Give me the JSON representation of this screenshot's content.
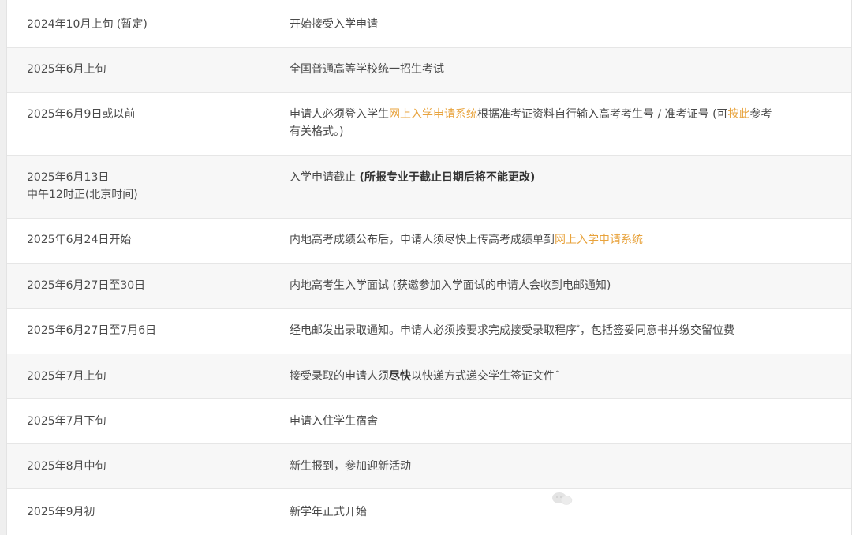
{
  "rows": [
    {
      "date": "2024年10月上旬 (暂定)",
      "desc": "开始接受入学申请"
    },
    {
      "date": "2025年6月上旬",
      "desc": "全国普通高等学校统一招生考试"
    },
    {
      "date": "2025年6月9日或以前",
      "desc_parts": {
        "p1": "申请人必须登入学生",
        "link1": "网上入学申请系统",
        "p2": "根据准考证资料自行输入高考考生号 / 准考证号 (可",
        "link2": "按此",
        "p3": "参考",
        "line2": "有关格式。)"
      }
    },
    {
      "date_line1": "2025年6月13日",
      "date_line2": "中午12时正(北京时间)",
      "desc_parts": {
        "p1": "入学申请截止 ",
        "bold": "(所报专业于截止日期后将不能更改)"
      }
    },
    {
      "date": "2025年6月24日开始",
      "desc_parts": {
        "p1": "内地高考成绩公布后，申请人须尽快上传高考成绩单到",
        "link": "网上入学申请系统"
      }
    },
    {
      "date": "2025年6月27日至30日",
      "desc": "内地高考生入学面试 (获邀参加入学面试的申请人会收到电邮通知)"
    },
    {
      "date": "2025年6月27日至7月6日",
      "desc_parts": {
        "p1": "经电邮发出录取通知。申请人必须按要求完成接受录取程序",
        "sup": "*",
        "p2": "，包括签妥同意书并缴交留位费"
      }
    },
    {
      "date": "2025年7月上旬",
      "desc_parts": {
        "p1": "接受录取的申请人须",
        "bold": "尽快",
        "p2": "以快递方式递交学生签证文件",
        "sup": "^"
      }
    },
    {
      "date": "2025年7月下旬",
      "desc": "申请入住学生宿舍"
    },
    {
      "date": "2025年8月中旬",
      "desc": "新生报到，参加迎新活动"
    },
    {
      "date": "2025年9月初",
      "desc": "新学年正式开始"
    }
  ],
  "colors": {
    "link": "#e8a33d",
    "text": "#4a4a4a",
    "row_alt": "#f7f7f7"
  },
  "icons": {
    "watermark": "chat-bubble-watermark-icon"
  }
}
